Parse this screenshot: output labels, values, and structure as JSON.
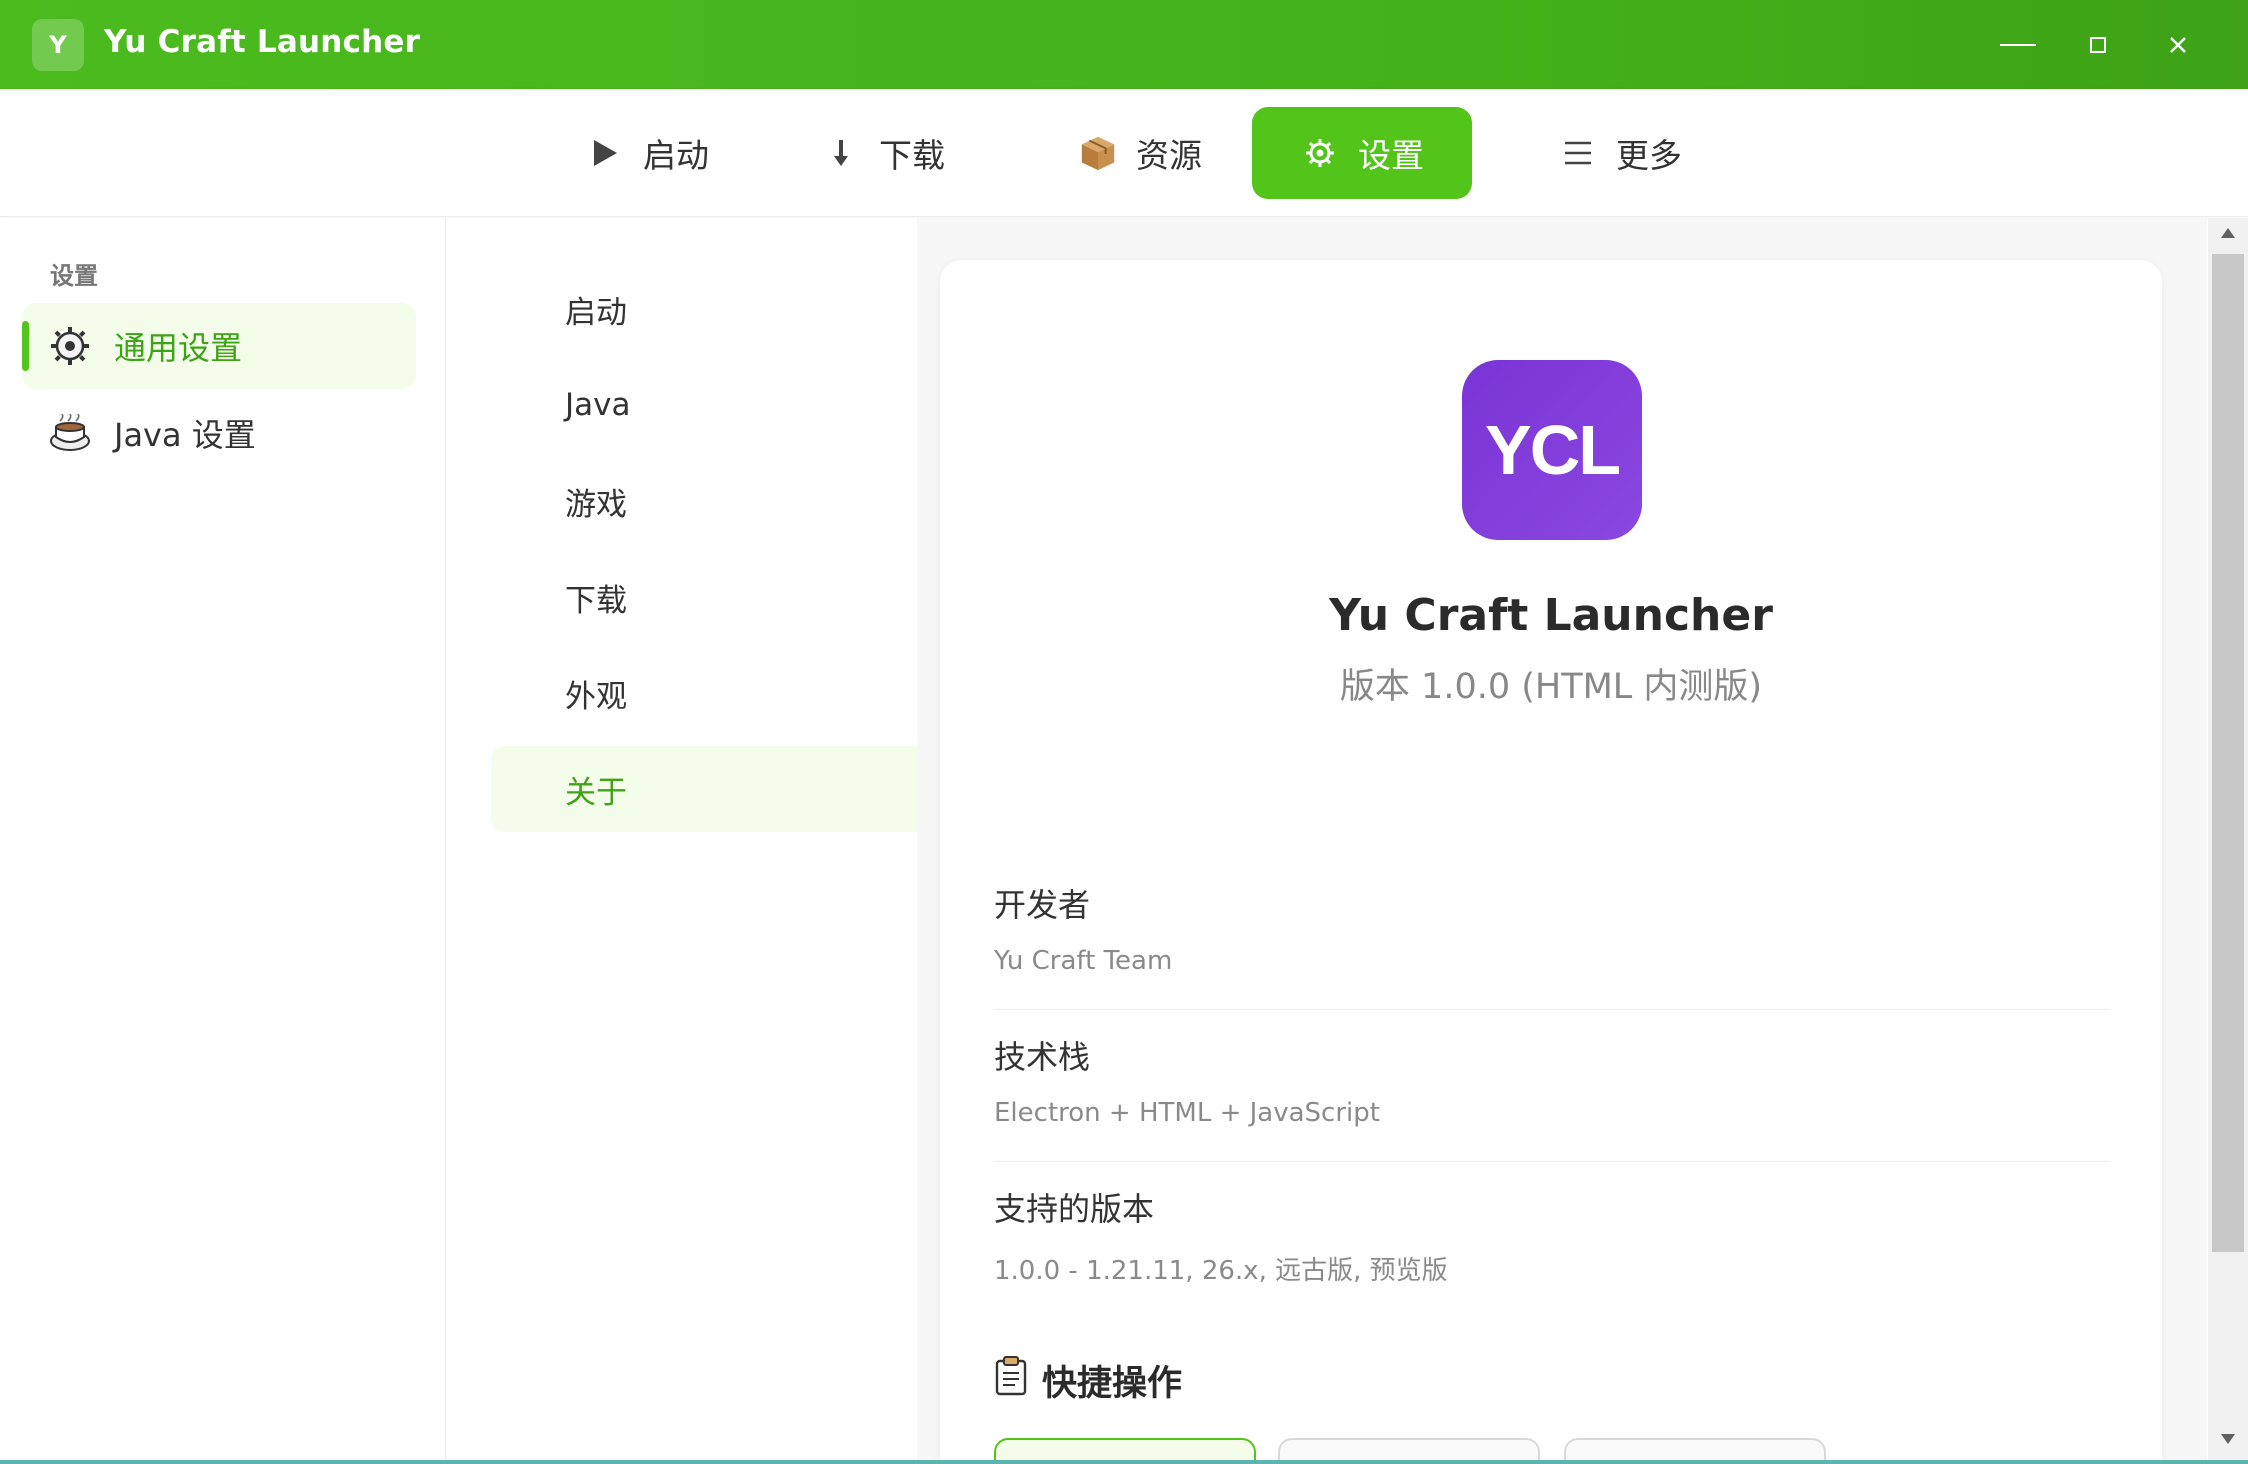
{
  "window": {
    "badge_letter": "Y",
    "title": "Yu Craft Launcher"
  },
  "topnav": {
    "launch": "启动",
    "download": "下载",
    "resources": "资源",
    "settings": "设置",
    "more": "更多"
  },
  "sidebar": {
    "heading": "设置",
    "items": [
      {
        "label": "通用设置",
        "icon": "gear-icon",
        "active": true
      },
      {
        "label": "Java 设置",
        "icon": "coffee-icon",
        "active": false
      }
    ]
  },
  "submenu": {
    "items": [
      {
        "label": "启动"
      },
      {
        "label": "Java"
      },
      {
        "label": "游戏"
      },
      {
        "label": "下载"
      },
      {
        "label": "外观"
      },
      {
        "label": "关于",
        "active": true
      }
    ]
  },
  "about": {
    "logo_text": "YCL",
    "name": "Yu Craft Launcher",
    "version": "版本 1.0.0 (HTML 内测版)",
    "rows": [
      {
        "label": "开发者",
        "value": "Yu Craft Team"
      },
      {
        "label": "技术栈",
        "value": "Electron + HTML + JavaScript"
      },
      {
        "label": "支持的版本",
        "value": "1.0.0 - 1.21.11, 26.x, 远古版, 预览版"
      }
    ],
    "quick_title": "快捷操作"
  },
  "colors": {
    "accent": "#52c41a",
    "titlebar": "#46b51b",
    "logo": "#7e3bd9"
  }
}
